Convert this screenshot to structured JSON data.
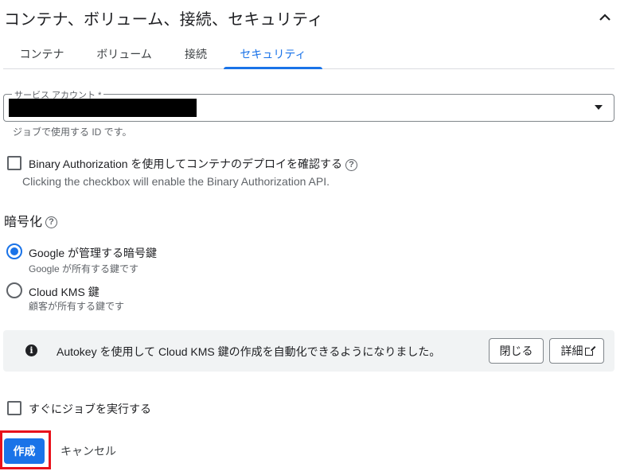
{
  "section": {
    "title": "コンテナ、ボリューム、接続、セキュリティ",
    "collapse_icon": "chevron-up-icon"
  },
  "tabs": [
    {
      "label": "コンテナ",
      "active": false
    },
    {
      "label": "ボリューム",
      "active": false
    },
    {
      "label": "接続",
      "active": false
    },
    {
      "label": "セキュリティ",
      "active": true
    }
  ],
  "service_account": {
    "label": "サービス アカウント *",
    "value_redacted": true,
    "helper": "ジョブで使用する ID です。"
  },
  "binary_auth": {
    "checked": false,
    "label": "Binary Authorization を使用してコンテナのデプロイを確認する",
    "help_icon": "help-icon",
    "sub": "Clicking the checkbox will enable the Binary Authorization API."
  },
  "encryption": {
    "title": "暗号化",
    "options": [
      {
        "label": "Google が管理する暗号鍵",
        "sub": "Google が所有する鍵です",
        "checked": true
      },
      {
        "label": "Cloud KMS 鍵",
        "sub": "顧客が所有する鍵です",
        "checked": false
      }
    ]
  },
  "banner": {
    "icon": "info-icon",
    "text": "Autokey を使用して Cloud KMS 鍵の作成を自動化できるようになりました。",
    "close_label": "閉じる",
    "details_label": "詳細"
  },
  "execute_now": {
    "checked": false,
    "label": "すぐにジョブを実行する"
  },
  "actions": {
    "create_label": "作成",
    "cancel_label": "キャンセル",
    "highlight_color": "#e8121b"
  },
  "colors": {
    "accent": "#1a73e8"
  }
}
